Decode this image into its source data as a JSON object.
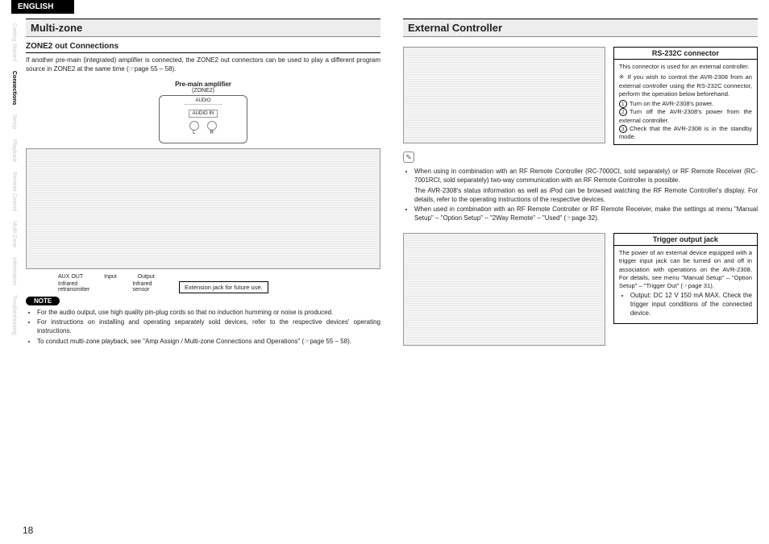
{
  "header": {
    "language": "ENGLISH"
  },
  "sidebar": {
    "items": [
      {
        "label": "Getting Started"
      },
      {
        "label": "Connections"
      },
      {
        "label": "Setup"
      },
      {
        "label": "Playback"
      },
      {
        "label": "Remote Control"
      },
      {
        "label": "Multi-Zone"
      },
      {
        "label": "Information"
      },
      {
        "label": "Troubleshooting"
      }
    ],
    "activeIndex": 1
  },
  "left": {
    "section_title": "Multi-zone",
    "subhead": "ZONE2 out Connections",
    "intro": "If another pre-main (integrated) amplifier is connected, the ZONE2 out connectors can be used to play a different program source in ZONE2 at the same time (☞page 55 – 58).",
    "fig": {
      "caption_top": "Pre-main amplifier",
      "caption_sub": "(ZONE2)",
      "audio_label": "AUDIO",
      "audio_in": "AUDIO\nIN",
      "left_label": "L",
      "right_label": "R",
      "aux_out": "AUX OUT",
      "input_label": "Input",
      "output_label": "Output",
      "infrared_retransmitter": "Infrared retransmitter",
      "infrared_sensor": "Infrared sensor",
      "extension_jack": "Extension jack for future use."
    },
    "note_badge": "NOTE",
    "notes": [
      "For the audio output, use high quality pin-plug cords so that no induction humming or noise is produced.",
      "For instructions on installing and operating separately sold devices, refer to the respective devices' operating instructions.",
      "To conduct multi-zone playback, see \"Amp Assign / Multi-zone Connections and Operations\" (☞page 55 – 58)."
    ]
  },
  "right": {
    "section_title": "External Controller",
    "rs232c": {
      "title": "RS-232C connector",
      "lead": "This connector is used for an external controller.",
      "star": "※ If you wish to control the AVR-2308 from an external controller using the RS-232C connector, perform the operation below beforehand.",
      "steps": [
        "Turn on the AVR-2308's power.",
        "Turn off the AVR-2308's power from the external controller.",
        "Check that the AVR-2308 is in the standby mode."
      ]
    },
    "pencil_notes": [
      "When using in combination with an RF Remote Controller (RC-7000CI, sold separately) or RF Remote Receiver (RC-7001RCI, sold separately) two-way communication with an RF Remote Controller is possible.",
      "The AVR-2308's status information as well as iPod  can be browsed watching the RF Remote Controller's display. For details, refer to the operating instructions of the respective devices.",
      "When used in combination with an RF Remote Controller or RF Remote Receiver, make the settings at menu \"Manual Setup\" – \"Option Setup\" – \"2Way Remote\" – \"Used\" (☞page 32)."
    ],
    "trigger": {
      "title": "Trigger output jack",
      "body": "The power of an external device equipped with a trigger input jack can be turned on and off in association with operations on the AVR-2308. For details, see menu \"Manual Setup\" – \"Option Setup\" – \"Trigger Out\" (☞page 31).",
      "bullet": "Output: DC 12 V 150 mA MAX.\nCheck the trigger input conditions of the connected device."
    }
  },
  "page_number": "18"
}
